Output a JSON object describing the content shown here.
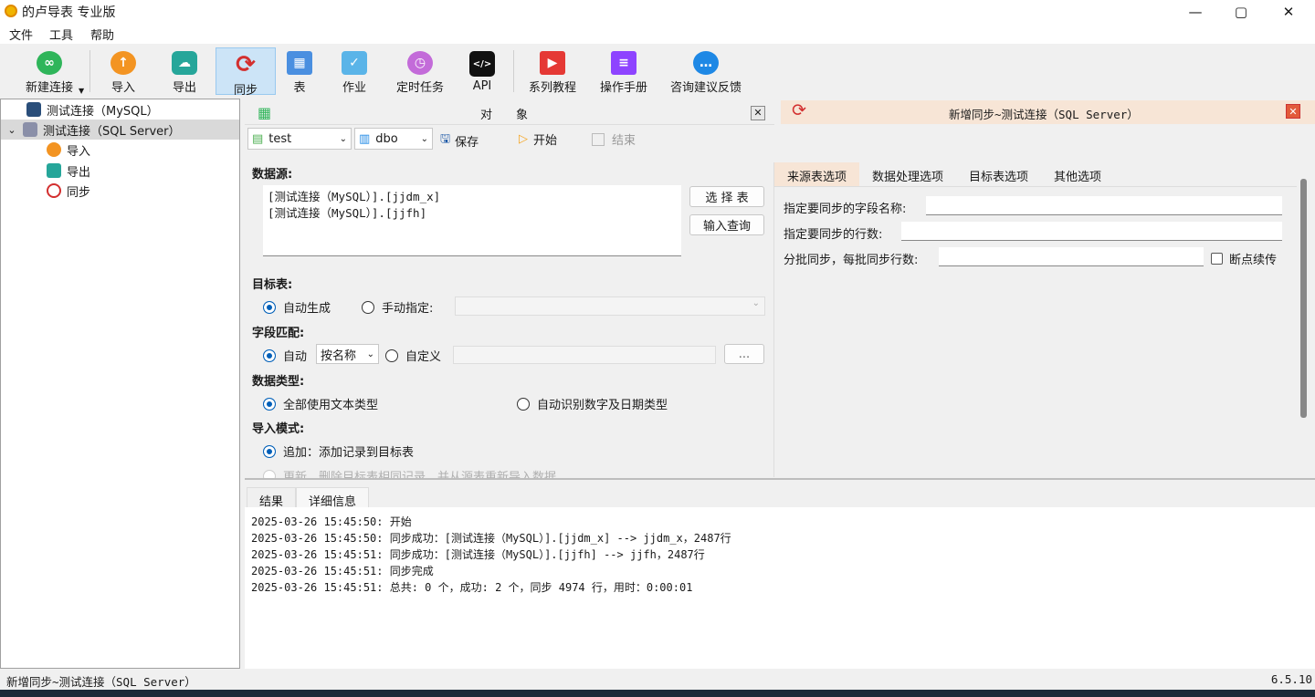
{
  "window": {
    "title": "的卢导表 专业版",
    "min": "—",
    "max": "▢",
    "close": "✕"
  },
  "menu": [
    "文件",
    "工具",
    "帮助"
  ],
  "toolbar": {
    "new_conn": "新建连接",
    "import": "导入",
    "export": "导出",
    "sync": "同步",
    "table": "表",
    "job": "作业",
    "schedule": "定时任务",
    "api": "API",
    "tutorial": "系列教程",
    "manual": "操作手册",
    "feedback": "咨询建议反馈"
  },
  "tree": {
    "conn1": "测试连接（MySQL）",
    "conn2": "测试连接（SQL Server）",
    "child_import": "导入",
    "child_export": "导出",
    "child_sync": "同步"
  },
  "objects_panel": {
    "title": "对　　象",
    "db_combo": "test",
    "schema_combo": "dbo",
    "save": "保存",
    "start": "开始",
    "end": "结束"
  },
  "source": {
    "label": "数据源:",
    "lines": [
      "[测试连接（MySQL）].[jjdm_x]",
      "[测试连接（MySQL）].[jjfh]"
    ],
    "select_table": "选 择 表",
    "input_query": "输入查询"
  },
  "target": {
    "label": "目标表:",
    "auto": "自动生成",
    "manual": "手动指定:"
  },
  "field_match": {
    "label": "字段匹配:",
    "auto": "自动",
    "by_name": "按名称",
    "custom": "自定义",
    "dots": "..."
  },
  "data_type": {
    "label": "数据类型:",
    "all_text": "全部使用文本类型",
    "auto_detect": "自动识别数字及日期类型"
  },
  "import_mode": {
    "label": "导入模式:",
    "append": "追加：添加记录到目标表",
    "update": "更新，删除目标表相同记录，并从源表重新导入数据"
  },
  "options_panel": {
    "title": "新增同步~测试连接（SQL Server）",
    "tabs": [
      "来源表选项",
      "数据处理选项",
      "目标表选项",
      "其他选项"
    ],
    "field_names": "指定要同步的字段名称:",
    "row_count": "指定要同步的行数:",
    "batch": "分批同步，每批同步行数:",
    "resume": "断点续传"
  },
  "result_tabs": [
    "结果",
    "详细信息"
  ],
  "log": [
    "2025-03-26 15:45:50: 开始",
    "2025-03-26 15:45:50: 同步成功：[测试连接（MySQL）].[jjdm_x] --> jjdm_x，2487行",
    "2025-03-26 15:45:51: 同步成功：[测试连接（MySQL）].[jjfh] --> jjfh，2487行",
    "2025-03-26 15:45:51: 同步完成",
    "2025-03-26 15:45:51: 总共: 0 个，成功: 2 个，同步 4974 行，用时：0:00:01"
  ],
  "status": {
    "left": "新增同步~测试连接（SQL Server）",
    "version": "6.5.10"
  }
}
